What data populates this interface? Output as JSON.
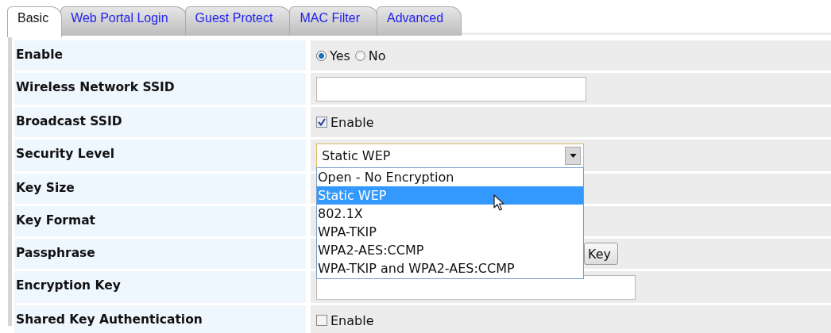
{
  "tabs": [
    {
      "label": "Basic",
      "selected": true
    },
    {
      "label": "Web Portal Login",
      "selected": false
    },
    {
      "label": "Guest Protect",
      "selected": false
    },
    {
      "label": "MAC Filter",
      "selected": false
    },
    {
      "label": "Advanced",
      "selected": false
    }
  ],
  "fields": [
    {
      "label": "Enable",
      "kind": "radio",
      "options": [
        {
          "label": "Yes",
          "selected": true
        },
        {
          "label": "No",
          "selected": false
        }
      ]
    },
    {
      "label": "Wireless Network SSID",
      "kind": "text"
    },
    {
      "label": "Broadcast SSID",
      "kind": "checkbox",
      "checked": true,
      "text": "Enable"
    },
    {
      "label": "Security Level",
      "kind": "select",
      "value": "Static WEP",
      "expanded": true,
      "options": [
        {
          "label": "Open - No Encryption",
          "selected": false
        },
        {
          "label": "Static WEP",
          "selected": true
        },
        {
          "label": "802.1X",
          "selected": false
        },
        {
          "label": "WPA-TKIP",
          "selected": false
        },
        {
          "label": "WPA2-AES:CCMP",
          "selected": false
        },
        {
          "label": "WPA-TKIP and WPA2-AES:CCMP",
          "selected": false
        }
      ]
    },
    {
      "label": "Key Size",
      "kind": "covered"
    },
    {
      "label": "Key Format",
      "kind": "covered"
    },
    {
      "label": "Passphrase",
      "kind": "button",
      "button": "Key"
    },
    {
      "label": "Encryption Key",
      "kind": "text"
    },
    {
      "label": "Shared Key Authentication",
      "kind": "checkbox",
      "checked": false,
      "text": "Enable"
    }
  ]
}
